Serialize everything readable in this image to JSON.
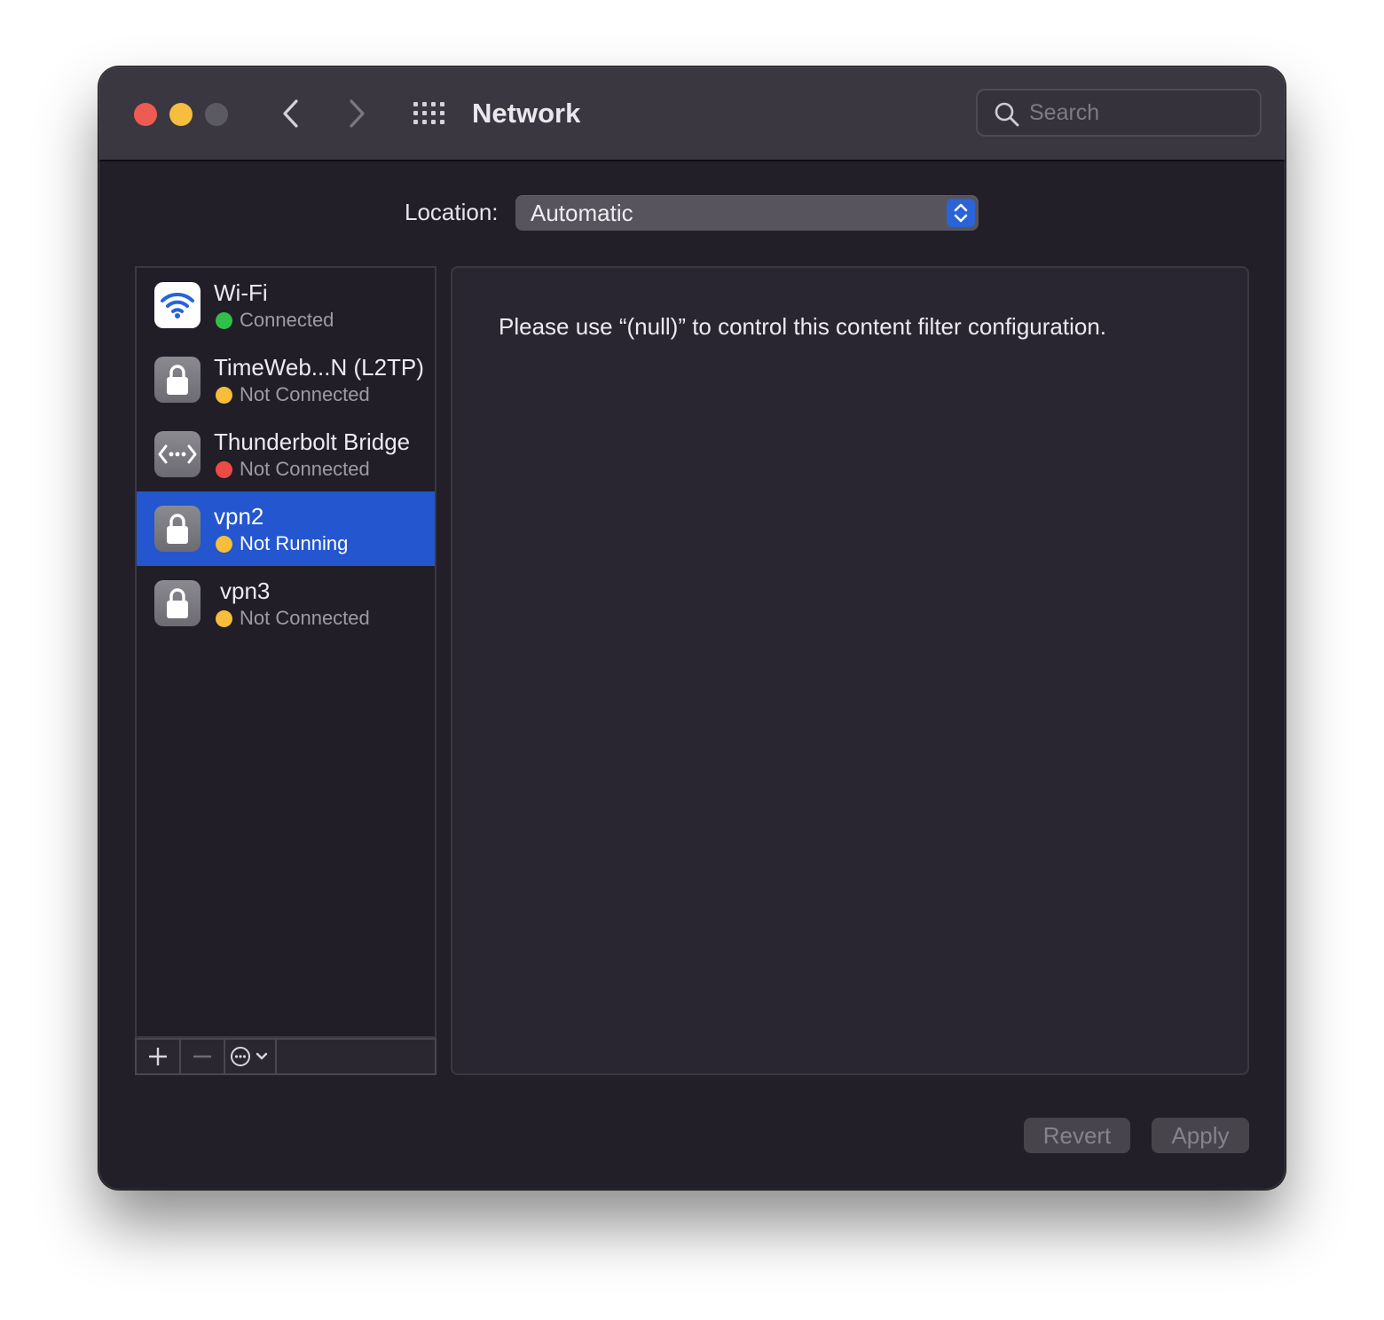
{
  "window": {
    "title": "Network"
  },
  "toolbar": {
    "back_icon": "chevron-left-icon",
    "forward_icon": "chevron-right-icon",
    "grid_icon": "show-all-grid-icon"
  },
  "search": {
    "placeholder": "Search",
    "value": ""
  },
  "location": {
    "label": "Location:",
    "value": "Automatic"
  },
  "services": [
    {
      "name": "Wi-Fi",
      "status": "Connected",
      "status_color": "#30c04a",
      "icon": "wifi-icon",
      "selected": false
    },
    {
      "name": "TimeWeb...N (L2TP)",
      "status": "Not Connected",
      "status_color": "#f6be3b",
      "icon": "lock-icon",
      "selected": false
    },
    {
      "name": "Thunderbolt Bridge",
      "status": "Not Connected",
      "status_color": "#ee4b45",
      "icon": "thunderbolt-bridge-icon",
      "selected": false
    },
    {
      "name": "vpn2",
      "status": "Not Running",
      "status_color": "#f6be3b",
      "icon": "lock-icon",
      "selected": true
    },
    {
      "name": "vpn3",
      "status": "Not Connected",
      "status_color": "#f6be3b",
      "icon": "lock-icon",
      "selected": false
    }
  ],
  "list_toolbar": {
    "add_icon": "plus-icon",
    "remove_icon": "minus-icon",
    "more_icon": "ellipsis-circle-icon"
  },
  "detail": {
    "message": "Please use “(null)” to control this content filter configuration."
  },
  "buttons": {
    "revert": "Revert",
    "apply": "Apply"
  },
  "colors": {
    "accent": "#2356cf",
    "close": "#ed5b53",
    "minimize": "#f5be3e",
    "zoom_inactive": "#5c5a61"
  }
}
